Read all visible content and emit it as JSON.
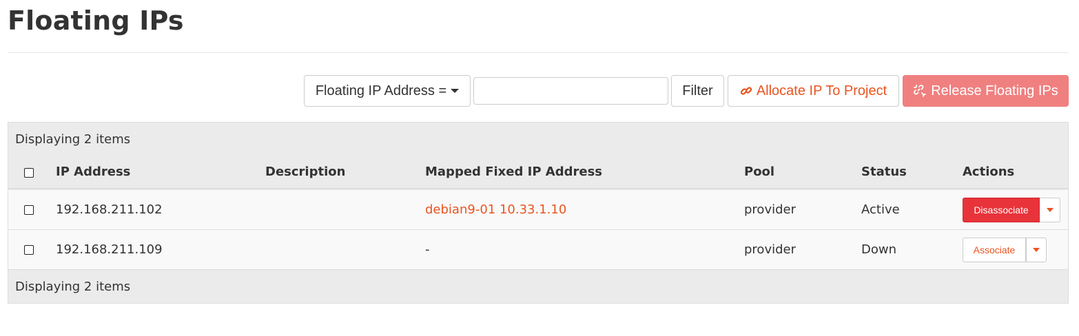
{
  "page": {
    "title": "Floating IPs"
  },
  "toolbar": {
    "filter_field_label": "Floating IP Address =",
    "filter_input_value": "",
    "filter_button": "Filter",
    "allocate_button": "Allocate IP To Project",
    "release_button": "Release Floating IPs"
  },
  "table": {
    "caption_top": "Displaying 2 items",
    "caption_bottom": "Displaying 2 items",
    "columns": [
      "IP Address",
      "Description",
      "Mapped Fixed IP Address",
      "Pool",
      "Status",
      "Actions"
    ],
    "rows": [
      {
        "ip": "192.168.211.102",
        "description": "",
        "mapped": "debian9-01 10.33.1.10",
        "pool": "provider",
        "status": "Active",
        "action": "Disassociate"
      },
      {
        "ip": "192.168.211.109",
        "description": "",
        "mapped": "-",
        "pool": "provider",
        "status": "Down",
        "action": "Associate"
      }
    ]
  },
  "colors": {
    "accent": "#e95420",
    "danger": "#e8333a",
    "danger_disabled": "#f08080"
  },
  "icons": {
    "allocate": "link-icon",
    "release": "unlink-icon",
    "dropdown": "caret-down-icon"
  }
}
